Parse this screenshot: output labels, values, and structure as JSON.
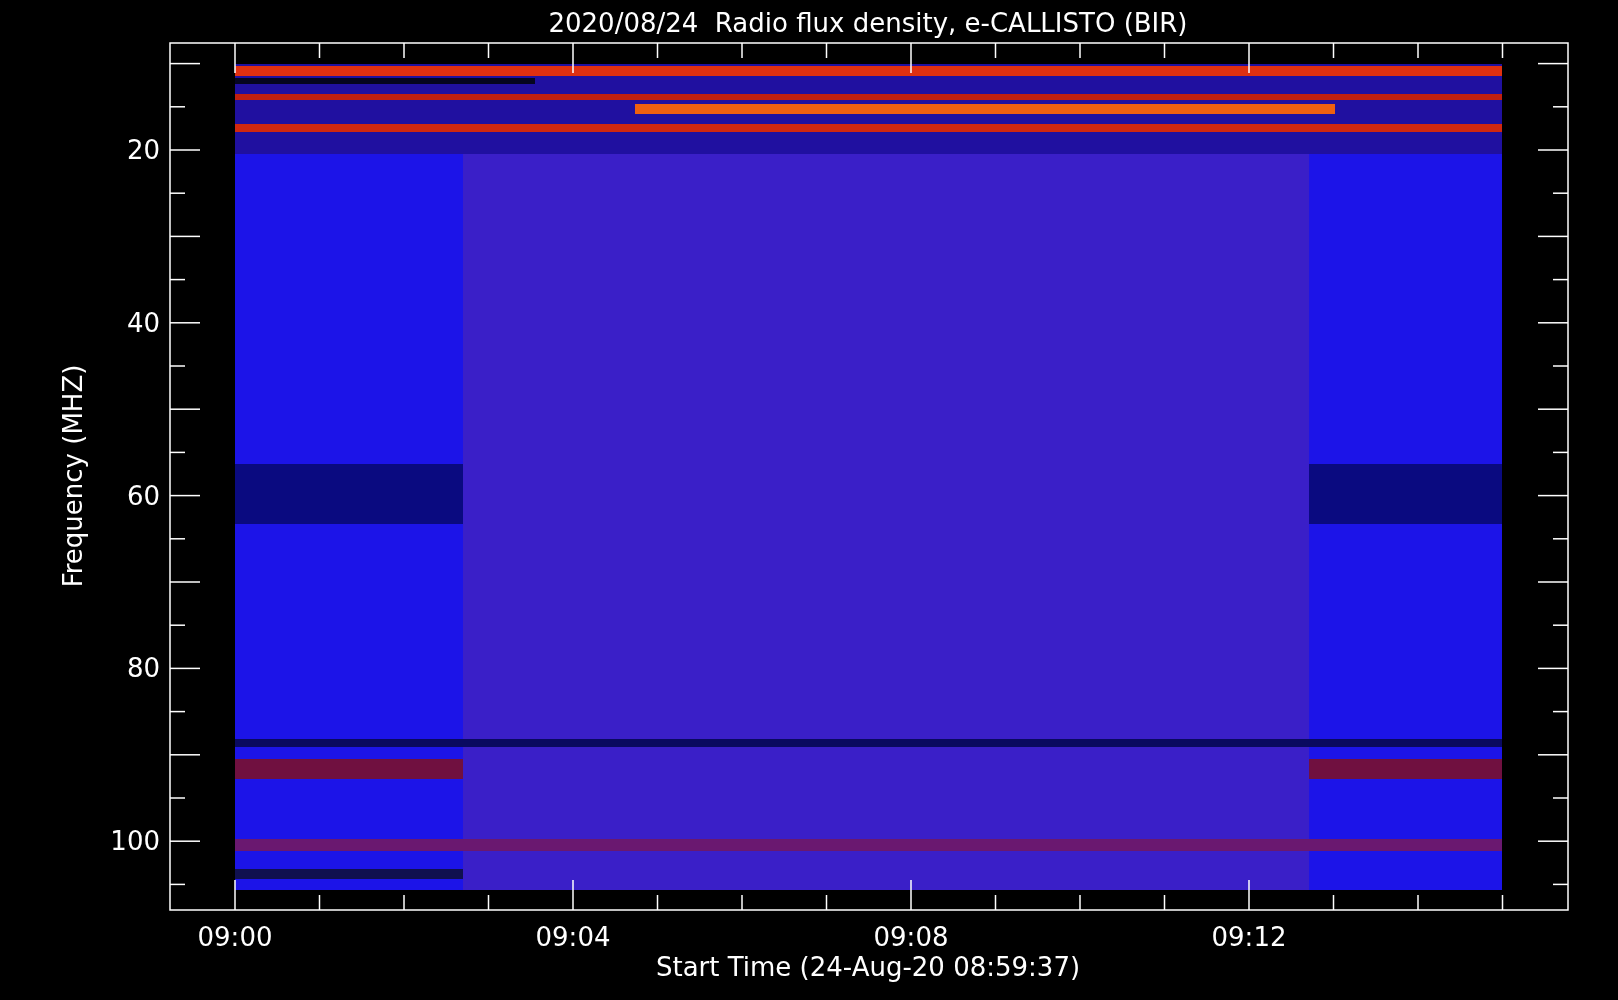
{
  "title": "2020/08/24  Radio flux density, e-CALLISTO (BIR)",
  "y_axis": {
    "label": "Frequency (MHZ)",
    "ticks": [
      "20",
      "40",
      "60",
      "80",
      "100"
    ]
  },
  "x_axis": {
    "label": "Start Time (24-Aug-20 08:59:37)",
    "ticks": [
      "09:00",
      "09:04",
      "09:08",
      "09:12"
    ]
  }
}
